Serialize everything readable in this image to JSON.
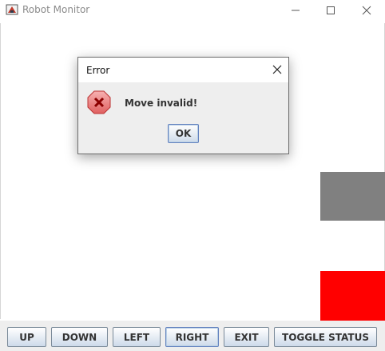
{
  "window": {
    "title": "Robot Monitor",
    "controls": [
      "minimize-icon",
      "maximize-icon",
      "close-icon"
    ]
  },
  "canvas": {
    "blocks": [
      {
        "name": "gray-block",
        "color": "#808080"
      },
      {
        "name": "red-block",
        "color": "#ff0000"
      }
    ]
  },
  "toolbar": {
    "up_label": "UP",
    "down_label": "DOWN",
    "left_label": "LEFT",
    "right_label": "RIGHT",
    "exit_label": "EXIT",
    "toggle_label": "TOGGLE STATUS"
  },
  "dialog": {
    "title": "Error",
    "message": "Move invalid!",
    "ok_label": "OK",
    "icon": "error-icon"
  }
}
